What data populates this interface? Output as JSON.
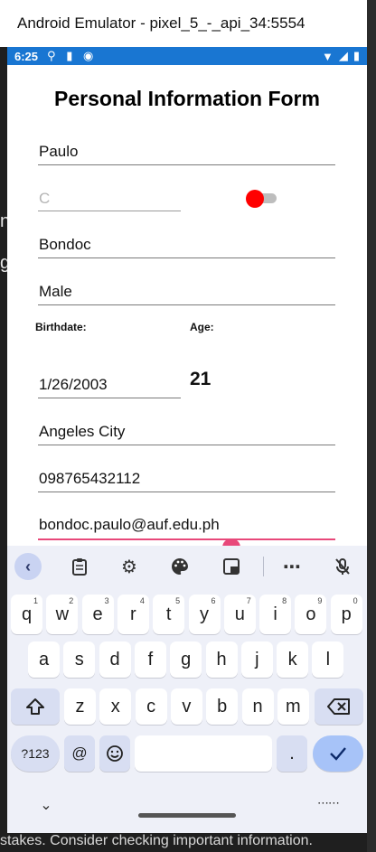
{
  "window": {
    "title": "Android Emulator - pixel_5_-_api_34:5554"
  },
  "status_bar": {
    "time": "6:25"
  },
  "form": {
    "title": "Personal Information Form",
    "first_name": "Paulo",
    "middle_initial_placeholder": "C",
    "last_name": "Bondoc",
    "gender": "Male",
    "birthdate_label": "Birthdate:",
    "age_label": "Age:",
    "birthdate": "1/26/2003",
    "age": "21",
    "address": "Angeles City",
    "phone": "098765432112",
    "email": "bondoc.paulo@auf.edu.ph"
  },
  "keyboard": {
    "row1": [
      {
        "k": "q",
        "h": "1"
      },
      {
        "k": "w",
        "h": "2"
      },
      {
        "k": "e",
        "h": "3"
      },
      {
        "k": "r",
        "h": "4"
      },
      {
        "k": "t",
        "h": "5"
      },
      {
        "k": "y",
        "h": "6"
      },
      {
        "k": "u",
        "h": "7"
      },
      {
        "k": "i",
        "h": "8"
      },
      {
        "k": "o",
        "h": "9"
      },
      {
        "k": "p",
        "h": "0"
      }
    ],
    "row2": [
      "a",
      "s",
      "d",
      "f",
      "g",
      "h",
      "j",
      "k",
      "l"
    ],
    "row3": [
      "z",
      "x",
      "c",
      "v",
      "b",
      "n",
      "m"
    ],
    "symbols_label": "?123",
    "at_label": "@",
    "period_label": "."
  },
  "background": {
    "footer_text": "stakes. Consider checking important information."
  },
  "colors": {
    "accent": "#1976d2",
    "focus": "#e8487a",
    "toggle_thumb": "#ff0000"
  }
}
